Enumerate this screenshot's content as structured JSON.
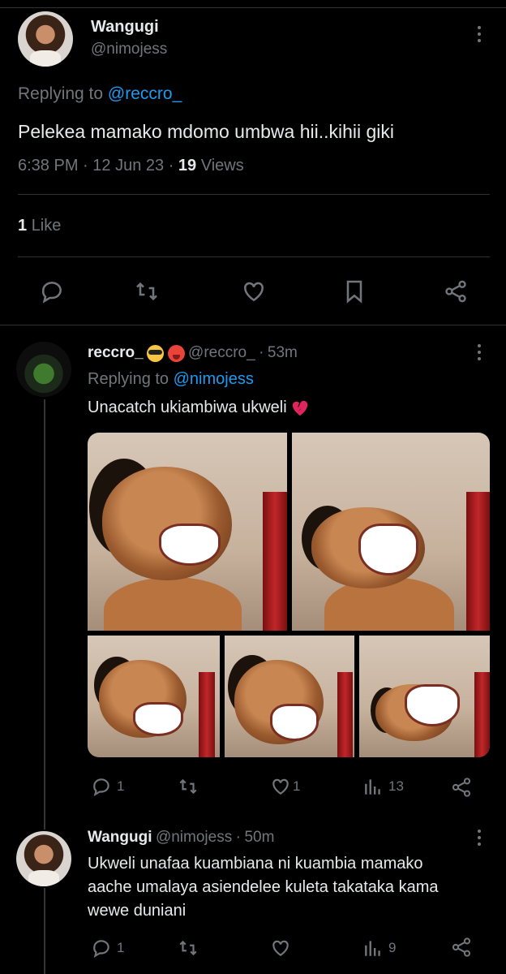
{
  "main_tweet": {
    "author_name": "Wangugi",
    "author_handle": "@nimojess",
    "replying_prefix": "Replying to",
    "replying_to": "@reccro_",
    "text": "Pelekea mamako mdomo umbwa hii..kihii giki",
    "time": "6:38 PM",
    "date": "12 Jun 23",
    "views_count": "19",
    "views_label": "Views",
    "likes_count": "1",
    "likes_label": "Like"
  },
  "reply1": {
    "author_name": "reccro_",
    "author_handle": "@reccro_",
    "age": "53m",
    "replying_prefix": "Replying to",
    "replying_to": "@nimojess",
    "text": "Unacatch ukiambiwa ukweli",
    "emojis": [
      "smiling-face-with-sunglasses",
      "hot-face",
      "broken-heart"
    ],
    "stats": {
      "replies": "1",
      "retweets": "",
      "likes": "1",
      "views": "13"
    }
  },
  "reply2": {
    "author_name": "Wangugi",
    "author_handle": "@nimojess",
    "age": "50m",
    "text_lines": [
      "Ukweli unafaa kuambiana ni kuambia mamako",
      "aache umalaya asiendelee kuleta takataka kama",
      "wewe duniani"
    ],
    "stats": {
      "replies": "1",
      "retweets": "",
      "likes": "",
      "views": "9"
    }
  },
  "colors": {
    "background": "#000000",
    "text": "#e7e9ea",
    "muted": "#71767b",
    "link": "#1d9bf0",
    "divider": "#2f3336"
  }
}
